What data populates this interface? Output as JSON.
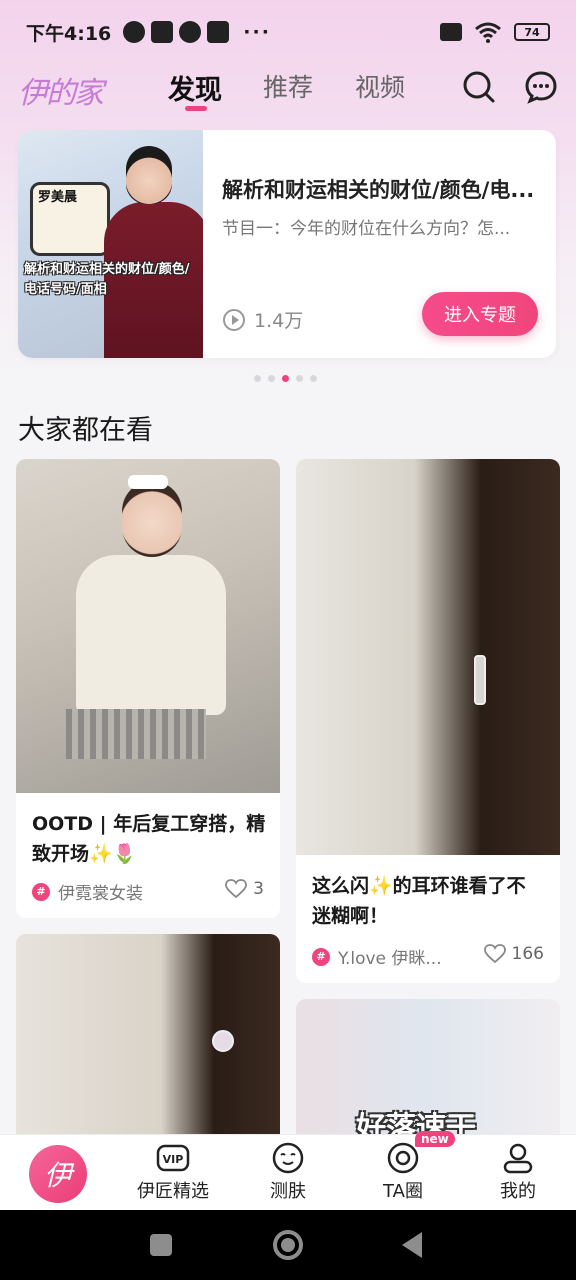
{
  "status_bar": {
    "time": "下午4:16",
    "dots": "···",
    "battery": "74"
  },
  "header": {
    "logo": "伊的家",
    "tabs": [
      {
        "label": "发现",
        "active": true
      },
      {
        "label": "推荐",
        "active": false
      },
      {
        "label": "视频",
        "active": false
      }
    ],
    "icons": [
      "search-icon",
      "message-icon"
    ]
  },
  "banner": {
    "image_sign": "罗美晨",
    "image_text": "解析和财运相关的财位/颜色/电话号码/面相",
    "title": "解析和财运相关的财位/颜色/电...",
    "subtitle": "节目一：今年的财位在什么方向？怎...",
    "views": "1.4万",
    "cta": "进入专题",
    "pager": {
      "count": 5,
      "active_index": 2
    }
  },
  "section": {
    "title": "大家都在看"
  },
  "feed": [
    {
      "title_line1": "OOTD | 年后复工穿搭，精",
      "title_line2": "致开场✨🌷",
      "author": "伊霓裳女装",
      "likes": "3"
    },
    {
      "title_line1": "这么闪✨的耳环谁看了不",
      "title_line2": "迷糊啊！",
      "author": "Y.love 伊眯...",
      "likes": "166"
    }
  ],
  "feed_partial_text": "好落速干",
  "bottom_nav": {
    "home_glyph": "伊",
    "items": [
      {
        "label": "伊匠精选",
        "icon": "vip-icon"
      },
      {
        "label": "测肤",
        "icon": "face-icon"
      },
      {
        "label": "TA圈",
        "icon": "circle-icon",
        "badge": "new"
      },
      {
        "label": "我的",
        "icon": "user-icon"
      }
    ]
  },
  "colors": {
    "accent": "#f0427c",
    "logo": "#c77bd8"
  }
}
